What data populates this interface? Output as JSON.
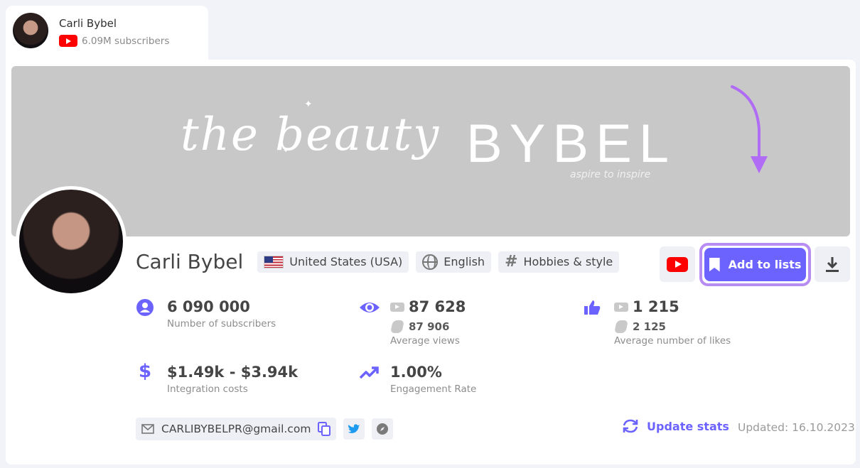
{
  "tab": {
    "name": "Carli Bybel",
    "subscribers": "6.09M subscribers"
  },
  "banner": {
    "script_text": "the beauty",
    "bold_text": "BYBEL",
    "tagline": "aspire to inspire"
  },
  "profile": {
    "name": "Carli Bybel",
    "country": "United States (USA)",
    "language": "English",
    "category": "Hobbies & style"
  },
  "actions": {
    "add_to_lists": "Add to lists"
  },
  "stats": {
    "subscribers": {
      "value": "6 090 000",
      "label": "Number of subscribers"
    },
    "views": {
      "value": "87 628",
      "shorts_value": "87 906",
      "label": "Average views"
    },
    "likes": {
      "value": "1 215",
      "shorts_value": "2 125",
      "label": "Average number of likes"
    },
    "costs": {
      "value": "$1.49k - $3.94k",
      "label": "Integration costs"
    },
    "engagement": {
      "value": "1.00%",
      "label": "Engagement Rate"
    }
  },
  "contact": {
    "email": "CARLIBYBELPR@gmail.com"
  },
  "footer": {
    "update_label": "Update stats",
    "updated_text": "Updated: 16.10.2023"
  },
  "colors": {
    "accent": "#6c63ff",
    "highlight_border": "#b78cf3",
    "youtube_red": "#ff0000",
    "twitter_blue": "#1d9bf0"
  }
}
